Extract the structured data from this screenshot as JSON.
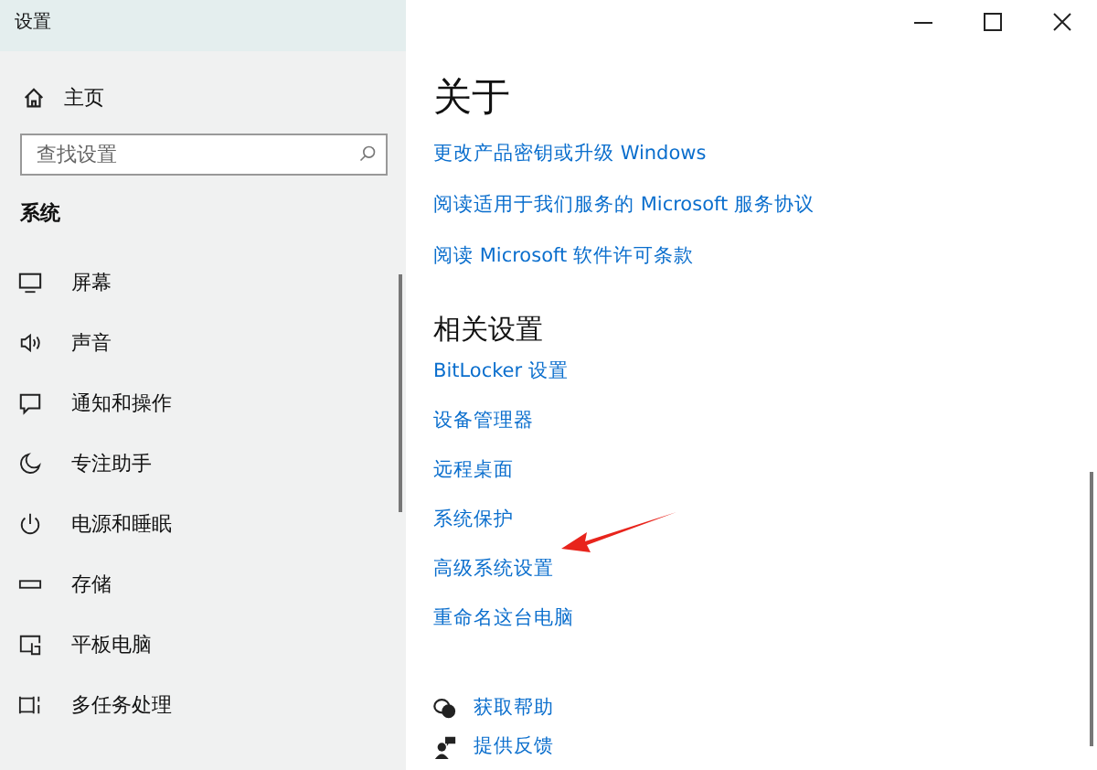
{
  "window": {
    "title": "设置"
  },
  "sidebar": {
    "home": "主页",
    "search": {
      "placeholder": "查找设置"
    },
    "section": "系统",
    "items": [
      {
        "label": "屏幕",
        "kind": "monitor"
      },
      {
        "label": "声音",
        "kind": "speaker"
      },
      {
        "label": "通知和操作",
        "kind": "message"
      },
      {
        "label": "专注助手",
        "kind": "moon"
      },
      {
        "label": "电源和睡眠",
        "kind": "power"
      },
      {
        "label": "存储",
        "kind": "storage"
      },
      {
        "label": "平板电脑",
        "kind": "tablet"
      },
      {
        "label": "多任务处理",
        "kind": "multitask"
      }
    ]
  },
  "content": {
    "title": "关于",
    "links": [
      "更改产品密钥或升级 Windows",
      "阅读适用于我们服务的 Microsoft 服务协议",
      "阅读 Microsoft 软件许可条款"
    ],
    "related_heading": "相关设置",
    "related_links": [
      "BitLocker 设置",
      "设备管理器",
      "远程桌面",
      "系统保护",
      "高级系统设置",
      "重命名这台电脑"
    ],
    "help_links": [
      {
        "label": "获取帮助",
        "kind": "help"
      },
      {
        "label": "提供反馈",
        "kind": "feedback"
      }
    ]
  }
}
